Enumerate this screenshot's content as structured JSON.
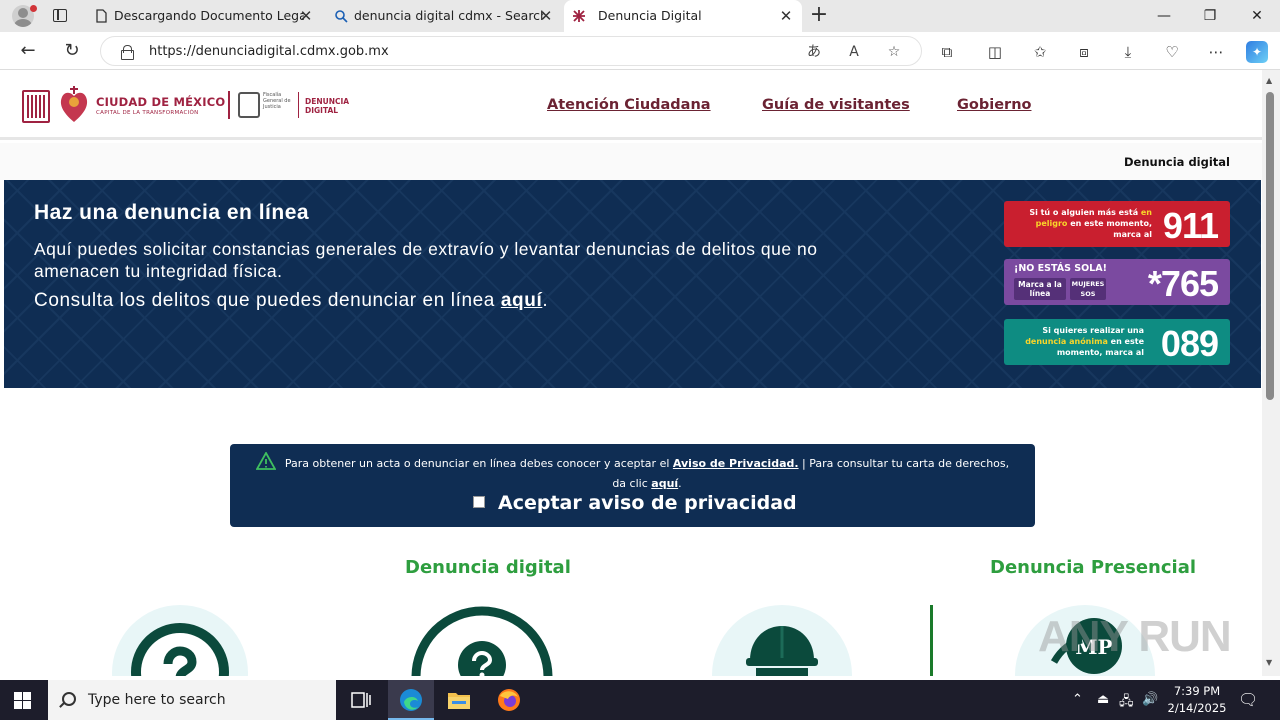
{
  "browser": {
    "tabs": [
      {
        "title": "Descargando Documento Legal",
        "icon": "document-icon"
      },
      {
        "title": "denuncia digital cdmx - Search",
        "icon": "search-icon"
      },
      {
        "title": "Denuncia Digital",
        "icon": "cdmx-favicon",
        "active": true
      }
    ],
    "url": "https://denunciadigital.cdmx.gob.mx"
  },
  "site": {
    "logo_cdmx_title": "CIUDAD DE MÉXICO",
    "logo_cdmx_sub": "CAPITAL DE LA TRANSFORMACIÓN",
    "logo_fgj_text": "Fiscalía General de Justicia",
    "logo_dd_line1": "DENUNCIA",
    "logo_dd_line2": "DIGITAL",
    "menu": [
      "Atención Ciudadana",
      "Guía de visitantes",
      "Gobierno"
    ],
    "breadcrumb": "Denuncia digital"
  },
  "hero": {
    "title": "Haz una denuncia en línea",
    "text1": "Aquí puedes solicitar constancias generales de extravío y levantar denuncias de delitos que no amenacen tu integridad física.",
    "text2_prefix": "Consulta los delitos que puedes denunciar en línea ",
    "text2_link": "aquí",
    "text2_suffix": "."
  },
  "emergency": {
    "e911": {
      "pre": "Si tú o alguien más está ",
      "hi": "en peligro",
      "post": " en este momento, marca al",
      "number": "911"
    },
    "e765": {
      "top": "¡NO ESTÁS SOLA!",
      "mid": "Marca a la línea",
      "brand": "MUJERES SOS",
      "number": "*765"
    },
    "e089": {
      "pre": "Si quieres realizar una ",
      "hi": "denuncia anónima",
      "post": " en este momento, marca al",
      "number": "089"
    }
  },
  "notice": {
    "text_a": "Para obtener un acta o denunciar en línea debes conocer y aceptar el ",
    "link_a": "Aviso de Privacidad.",
    "text_b": " | Para consultar tu carta de derechos, da clic ",
    "link_b": "aquí",
    "text_c": ".",
    "checkbox_label": "Aceptar aviso de privacidad"
  },
  "sections": {
    "digital": "Denuncia digital",
    "presencial": "Denuncia Presencial"
  },
  "watermark": "ANY RUN",
  "taskbar": {
    "search_placeholder": "Type here to search",
    "time": "7:39 PM",
    "date": "2/14/2025"
  },
  "colors": {
    "brand": "#9f2241",
    "hero_bg": "#0f2d53",
    "green": "#2e9e3f",
    "e911": "#c91f2f",
    "e765": "#7b4aa0",
    "e089": "#0e8c82"
  }
}
